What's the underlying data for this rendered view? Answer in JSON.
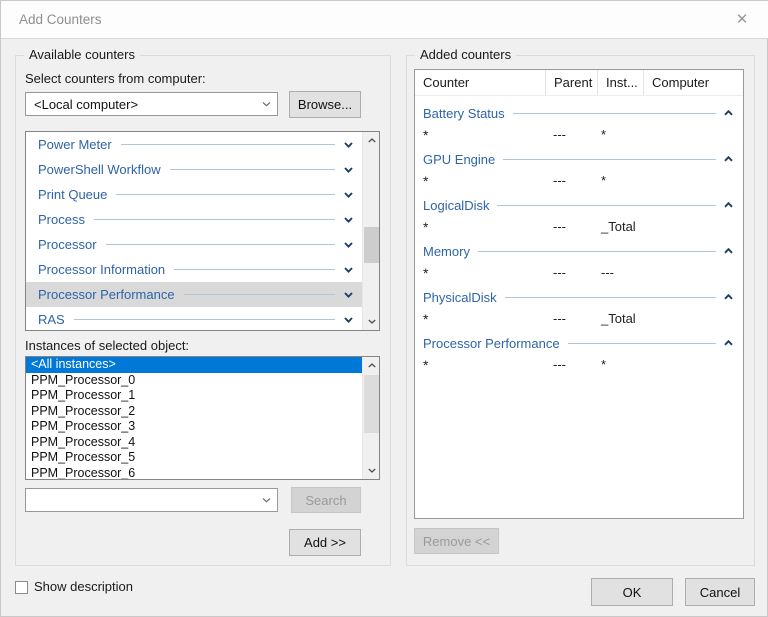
{
  "window": {
    "title": "Add Counters",
    "close_icon": "✕"
  },
  "available": {
    "group_label": "Available counters",
    "select_label": "Select counters from computer:",
    "computer_combo": {
      "value": "<Local computer>"
    },
    "browse_button": "Browse...",
    "counters": [
      {
        "label": "Power Meter",
        "selected": false
      },
      {
        "label": "PowerShell Workflow",
        "selected": false
      },
      {
        "label": "Print Queue",
        "selected": false
      },
      {
        "label": "Process",
        "selected": false
      },
      {
        "label": "Processor",
        "selected": false
      },
      {
        "label": "Processor Information",
        "selected": false
      },
      {
        "label": "Processor Performance",
        "selected": true
      },
      {
        "label": "RAS",
        "selected": false
      }
    ],
    "instances_label": "Instances of selected object:",
    "instances": [
      {
        "label": "<All instances>",
        "selected": true
      },
      {
        "label": "PPM_Processor_0",
        "selected": false
      },
      {
        "label": "PPM_Processor_1",
        "selected": false
      },
      {
        "label": "PPM_Processor_2",
        "selected": false
      },
      {
        "label": "PPM_Processor_3",
        "selected": false
      },
      {
        "label": "PPM_Processor_4",
        "selected": false
      },
      {
        "label": "PPM_Processor_5",
        "selected": false
      },
      {
        "label": "PPM_Processor_6",
        "selected": false
      }
    ],
    "search_combo": {
      "value": ""
    },
    "search_button": {
      "label": "Search",
      "enabled": false
    },
    "add_button": {
      "label": "Add >>",
      "enabled": true
    }
  },
  "added": {
    "group_label": "Added counters",
    "columns": [
      "Counter",
      "Parent",
      "Inst...",
      "Computer"
    ],
    "groups": [
      {
        "name": "Battery Status",
        "counter": "*",
        "parent": "---",
        "instances": "*",
        "computer": ""
      },
      {
        "name": "GPU Engine",
        "counter": "*",
        "parent": "---",
        "instances": "*",
        "computer": ""
      },
      {
        "name": "LogicalDisk",
        "counter": "*",
        "parent": "---",
        "instances": "_Total",
        "computer": ""
      },
      {
        "name": "Memory",
        "counter": "*",
        "parent": "---",
        "instances": "---",
        "computer": ""
      },
      {
        "name": "PhysicalDisk",
        "counter": "*",
        "parent": "---",
        "instances": "_Total",
        "computer": ""
      },
      {
        "name": "Processor Performance",
        "counter": "*",
        "parent": "---",
        "instances": "*",
        "computer": ""
      }
    ],
    "remove_button": {
      "label": "Remove <<",
      "enabled": false
    }
  },
  "footer": {
    "show_description_label": "Show description",
    "show_description_checked": false,
    "ok_button": "OK",
    "cancel_button": "Cancel"
  },
  "colors": {
    "accent_blue_text": "#2e64a8",
    "selection_blue": "#0078d7",
    "chevron_navy": "#1d3f66",
    "dialog_bg": "#f0f0f0"
  }
}
